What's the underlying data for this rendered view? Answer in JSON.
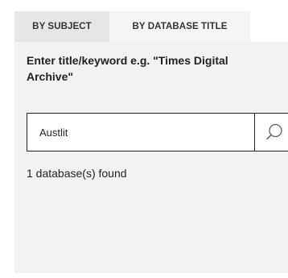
{
  "tabs": [
    {
      "label": "BY SUBJECT",
      "active": false
    },
    {
      "label": "BY DATABASE TITLE",
      "active": true
    }
  ],
  "search": {
    "prompt": "Enter title/keyword e.g. \"Times Digital Archive\"",
    "value": "Austlit",
    "button_icon": "search-icon"
  },
  "results": {
    "count_text": "1 database(s) found"
  },
  "colors": {
    "tab_inactive_bg": "#e6e6e6",
    "tab_active_bg": "#f5f5f5",
    "panel_bg": "#f2f2f2",
    "border": "#222222",
    "text": "#222222"
  }
}
